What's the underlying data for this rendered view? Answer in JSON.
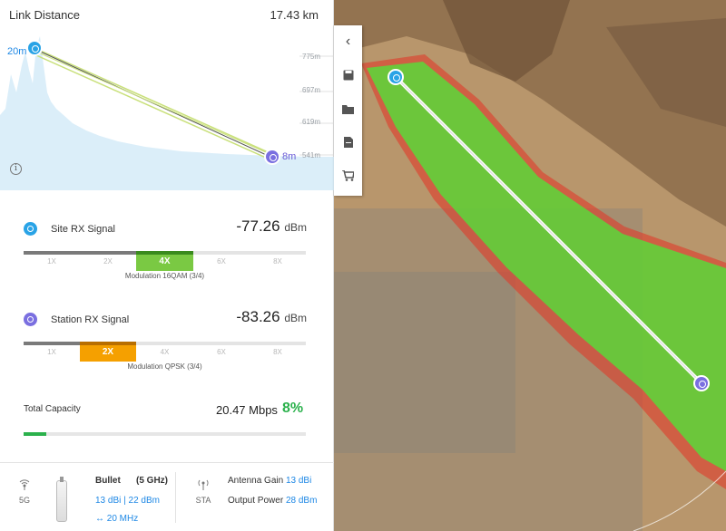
{
  "header": {
    "title": "Link Distance",
    "distance": "17.43 km"
  },
  "profile": {
    "elevations": [
      "775m",
      "697m",
      "619m",
      "541m"
    ],
    "site_height": "20m",
    "station_height": "8m"
  },
  "site_signal": {
    "label": "Site RX Signal",
    "value": "-77.26",
    "unit": "dBm",
    "levels": [
      "1X",
      "2X",
      "4X",
      "6X",
      "8X"
    ],
    "active_level": "4X",
    "modulation": "Modulation 16QAM (3/4)",
    "active_color": "#7ac943"
  },
  "station_signal": {
    "label": "Station RX Signal",
    "value": "-83.26",
    "unit": "dBm",
    "levels": [
      "1X",
      "2X",
      "4X",
      "6X",
      "8X"
    ],
    "active_level": "2X",
    "modulation": "Modulation QPSK (3/4)",
    "active_color": "#f5a000"
  },
  "capacity": {
    "label": "Total Capacity",
    "value": "20.47 Mbps",
    "percent_text": "8%",
    "percent": 8
  },
  "footer": {
    "band_icon_label": "5G",
    "device_name": "Bullet",
    "device_band": "(5 GHz)",
    "device_spec": "13 dBi | 22 dBm",
    "channel_width": "↔ 20 MHz",
    "mode_label": "STA",
    "antenna_gain_label": "Antenna Gain",
    "antenna_gain_value": "13 dBi",
    "output_power_label": "Output Power",
    "output_power_value": "28 dBm"
  },
  "toolbar": {
    "icons": [
      "chevron-left-icon",
      "save-icon",
      "folder-icon",
      "document-icon",
      "cart-icon"
    ]
  },
  "colors": {
    "accent_blue": "#29a3e6",
    "station_purple": "#7a6fe0",
    "coverage_green": "#52e03a",
    "coverage_red": "#e03a2a",
    "capacity_green": "#2bb14c"
  }
}
